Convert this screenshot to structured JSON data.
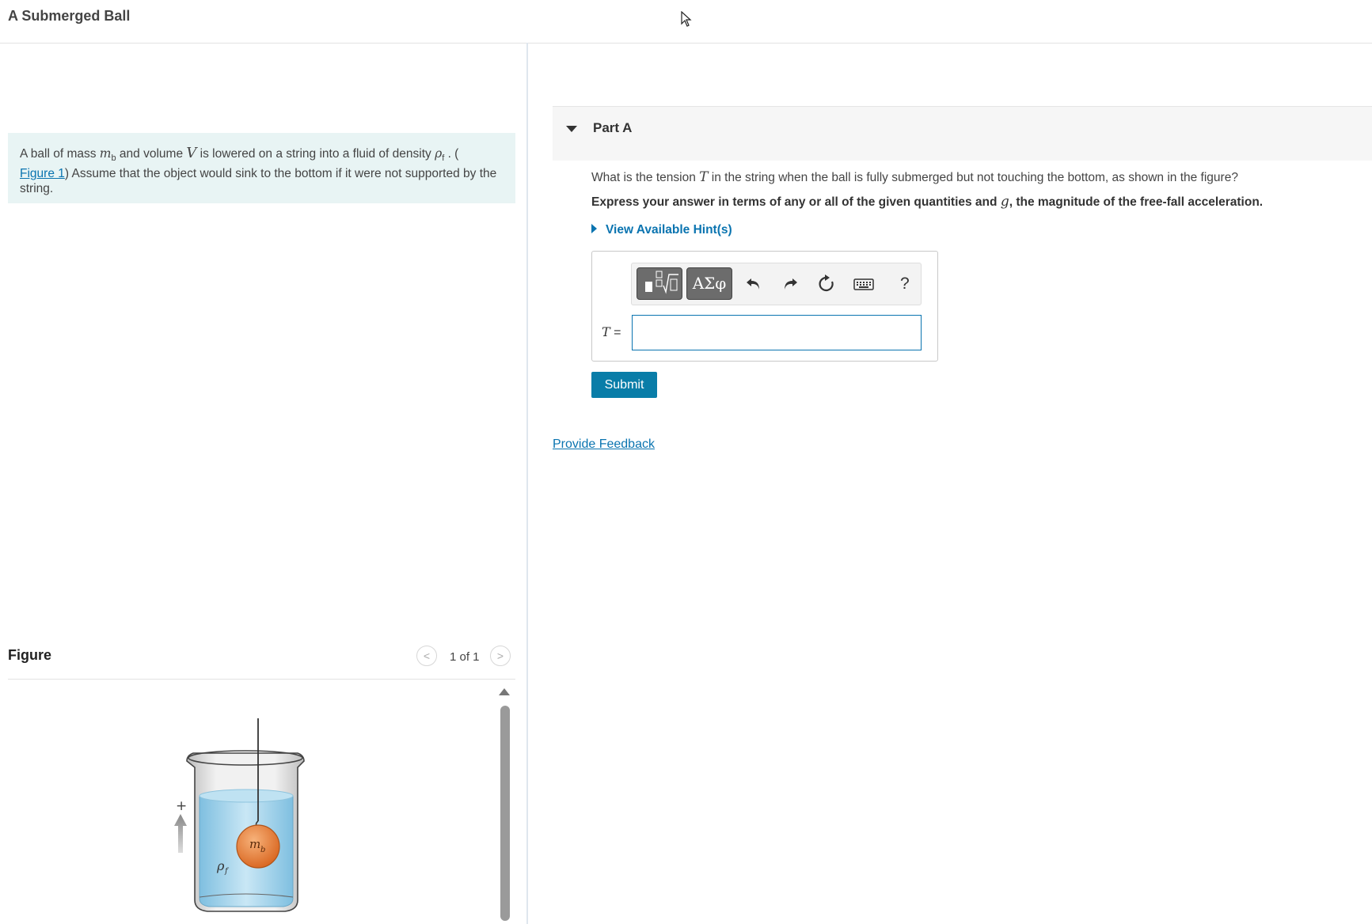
{
  "header": {
    "title": "A Submerged Ball"
  },
  "intro": {
    "text_1": "A ball of mass ",
    "mass_symbol": "m",
    "mass_subscript": "b",
    "text_2": " and volume ",
    "volume_symbol": "V",
    "text_3": " is lowered on a string into a fluid of density ",
    "density_symbol": "ρ",
    "density_subscript": "f",
    "text_4": " . (",
    "figure_link": "Figure 1",
    "text_5": ") Assume that the object would sink to the bottom if it were not supported by the string."
  },
  "figure": {
    "heading": "Figure",
    "pager": "1 of 1",
    "prev_icon": "chevron-left-icon",
    "next_icon": "chevron-right-icon",
    "labels": {
      "plus": "+",
      "ball": "m",
      "ball_sub": "b",
      "fluid": "ρ",
      "fluid_sub": "f"
    },
    "colors": {
      "ball": "#e8772e",
      "water": "#a9d6ec",
      "beaker": "#d8d8d8"
    }
  },
  "part": {
    "label": "Part A",
    "question_1": "What is the tension ",
    "question_symbol": "T",
    "question_2": " in the string when the ball is fully submerged but not touching the bottom, as shown in the figure?",
    "instruction_1": "Express your answer in terms of any or all of the given quantities and ",
    "instruction_symbol": "g",
    "instruction_2": ", the magnitude of the free-fall acceleration.",
    "hints": "View Available Hint(s)"
  },
  "toolbar": {
    "greek_label": "ΑΣφ",
    "templates_icon": "math-templates-icon",
    "undo_icon": "undo-icon",
    "redo_icon": "redo-icon",
    "reset_icon": "reset-icon",
    "keyboard_icon": "keyboard-icon",
    "help_label": "?"
  },
  "answer": {
    "label_symbol": "T",
    "label_equals": " =",
    "value": ""
  },
  "actions": {
    "submit": "Submit",
    "feedback": "Provide Feedback"
  },
  "theme": {
    "accent": "#0a74b0",
    "submit_bg": "#097da8",
    "intro_bg": "#e8f4f4"
  }
}
